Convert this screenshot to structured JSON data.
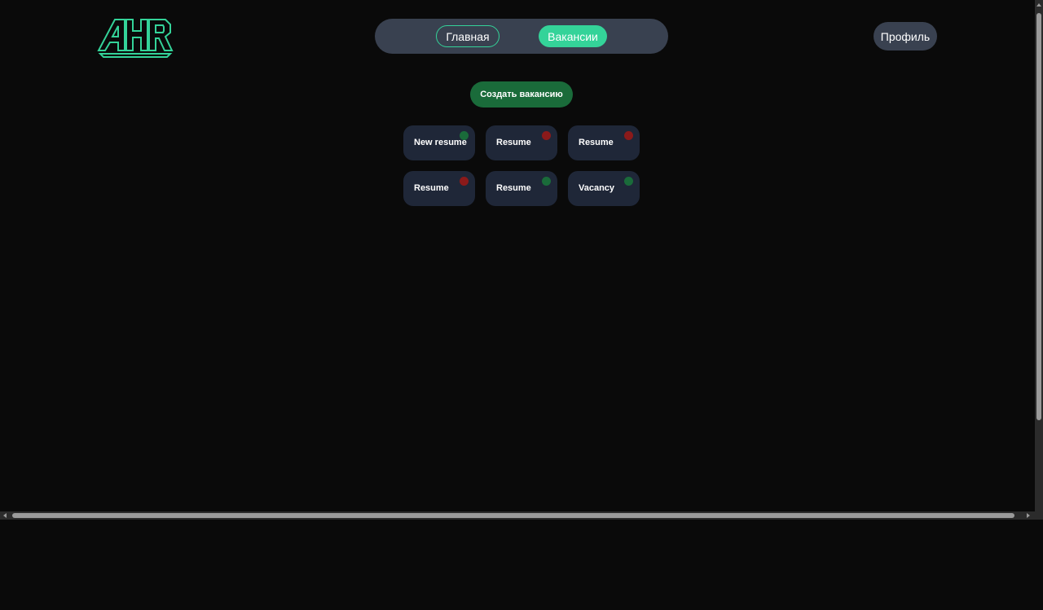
{
  "logo": {
    "text": "AHR",
    "color": "#34d399"
  },
  "nav": {
    "tabs": [
      {
        "label": "Главная",
        "active": false
      },
      {
        "label": "Вакансии",
        "active": true
      }
    ],
    "accent_color": "#34d399"
  },
  "header": {
    "profile_label": "Профиль"
  },
  "main": {
    "create_button_label": "Создать вакансию",
    "cards": [
      {
        "label": "New resume",
        "status": "green"
      },
      {
        "label": "Resume",
        "status": "red"
      },
      {
        "label": "Resume",
        "status": "red"
      },
      {
        "label": "Resume",
        "status": "red"
      },
      {
        "label": "Resume",
        "status": "green"
      },
      {
        "label": "Vacancy",
        "status": "green"
      }
    ]
  },
  "colors": {
    "background": "#0a0a0a",
    "pill": "#394150",
    "card": "#1f2738",
    "status_green": "#1a6b3a",
    "status_red": "#8b1a1a"
  }
}
